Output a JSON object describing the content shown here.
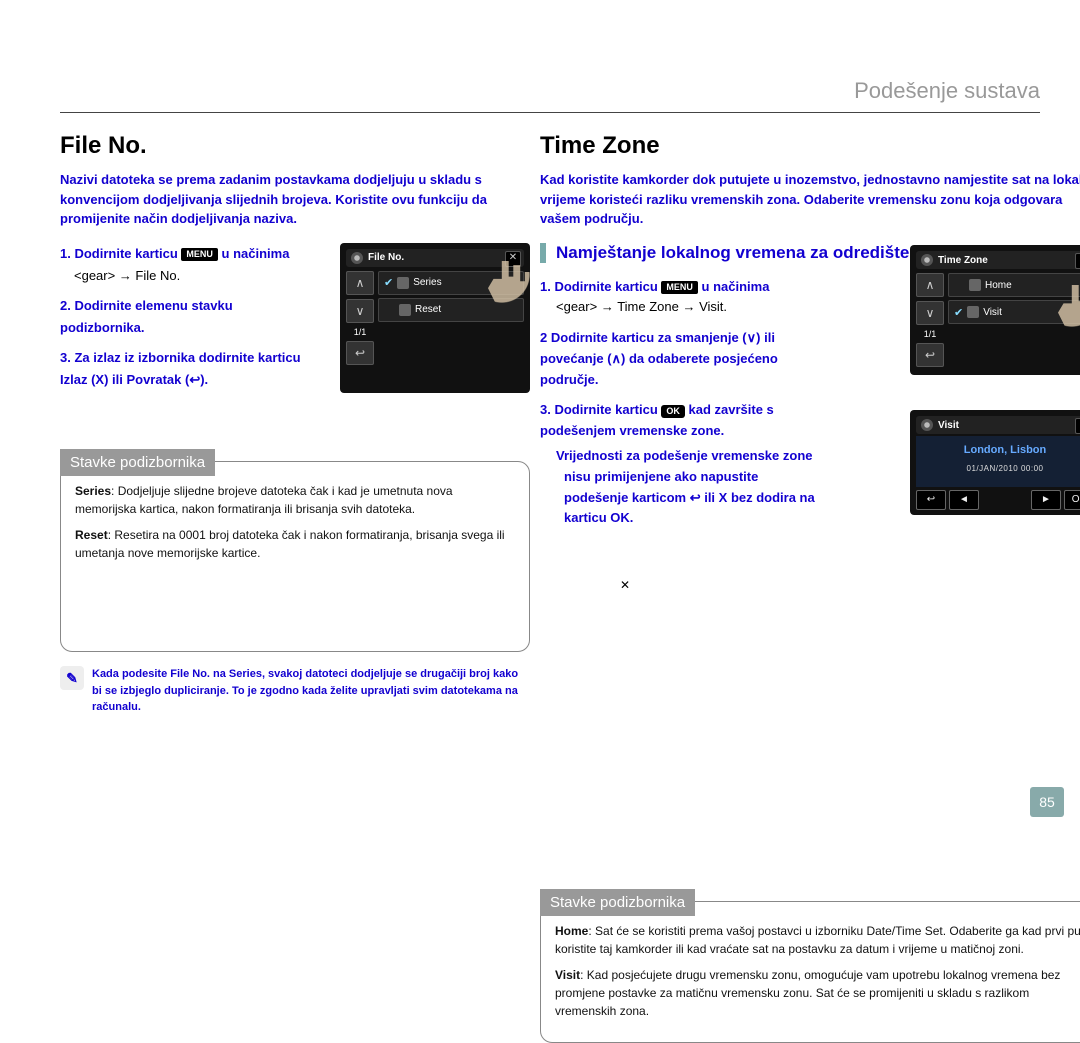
{
  "page": {
    "header": "Podešenje sustava",
    "page_number": "85"
  },
  "left": {
    "title": "File No.",
    "intro": "Nazivi datoteka se prema zadanim postavkama dodjeljuju u skladu s konvencijom dodjeljivanja slijednih brojeva. Koristite ovu funkciju da promijenite način dodjeljivanja naziva.",
    "steps": [
      {
        "n": "1.",
        "text": "Dodirnite karticu",
        "menu_pill": "MENU",
        "after": "u načinima",
        "sub": "<gear> → File No."
      },
      {
        "n": "2.",
        "text": "Dodirnite elemenu stavku podizbornika."
      },
      {
        "n": "3.",
        "text": "Za izlaz iz izbornika dodirnite karticu Izlaz (X) ili Povratak (↩)."
      }
    ],
    "screenshot1": {
      "header": "File No.",
      "count": "1/1",
      "rows": [
        {
          "selected": true,
          "icon": "series-icon",
          "label": "Series"
        },
        {
          "selected": false,
          "icon": "reset-icon",
          "label": "Reset"
        }
      ],
      "close": "✕"
    },
    "sub_label": "Stavke podizbornika",
    "sub_items": [
      {
        "name": "Series",
        "desc": "Dodjeljuje slijedne brojeve datoteka čak i kad je umetnuta nova memorijska kartica, nakon formatiranja ili brisanja svih datoteka."
      },
      {
        "name": "Reset",
        "desc": "Resetira na 0001 broj datoteka čak i nakon formatiranja, brisanja svega ili umetanja nove memorijske kartice."
      }
    ],
    "note": "Kada podesite File No. na Series, svakoj datoteci dodjeljuje se drugačiji broj kako bi se izbjeglo dupliciranje. To je zgodno kada želite upravljati svim datotekama na računalu."
  },
  "right": {
    "title": "Time Zone",
    "intro": "Kad koristite kamkorder dok putujete u inozemstvo, jednostavno namjestite sat na lokalno vrijeme koristeći razliku vremenskih zona. Odaberite vremensku zonu koja odgovara vašem području.",
    "sub_section": "Namještanje lokalnog vremena za odredište u koje putujete",
    "steps": [
      {
        "n": "1.",
        "text": "Dodirnite karticu",
        "menu_pill": "MENU",
        "after": "u načinima",
        "sub": "<gear> → Time Zone → Visit."
      },
      {
        "n": "2",
        "text": "Dodirnite karticu za smanjenje (∨) ili povećanje (∧) da odaberete posjećeno područje."
      },
      {
        "n": "3.",
        "text": "Dodirnite karticu",
        "ok_pill": "OK",
        "after2": "kad završite s podešenjem vremenske zone.",
        "bullets": [
          "Vrijednosti za podešenje vremenske zone nisu primijenjene ako napustite podešenje karticom ↩ ili X bez dodira na karticu OK."
        ]
      }
    ],
    "screenshot_r1": {
      "header": "Time Zone",
      "count": "1/1",
      "rows": [
        {
          "selected": false,
          "icon": "home-icon",
          "label": "Home"
        },
        {
          "selected": true,
          "icon": "visit-icon",
          "label": "Visit"
        }
      ],
      "close": "✕"
    },
    "screenshot_r2": {
      "header": "Visit",
      "city": "London, Lisbon",
      "clock": "01/JAN/2010 00:00",
      "close": "✕",
      "ok_label": "OK"
    },
    "sub_label": "Stavke podizbornika",
    "sub_items": [
      {
        "name": "Home",
        "desc": "Sat će se koristiti prema vašoj postavci u izborniku Date/Time Set. Odaberite ga kad prvi put koristite taj kamkorder ili kad vraćate sat na postavku za datum i vrijeme u matičnoj zoni."
      },
      {
        "name": "Visit",
        "desc": "Kad posjećujete drugu vremensku zonu, omogućuje vam upotrebu lokalnog vremena bez promjene postavke za matičnu vremensku zonu. Sat će se promijeniti u skladu s razlikom vremenskih zona."
      }
    ]
  },
  "stray": "✕"
}
